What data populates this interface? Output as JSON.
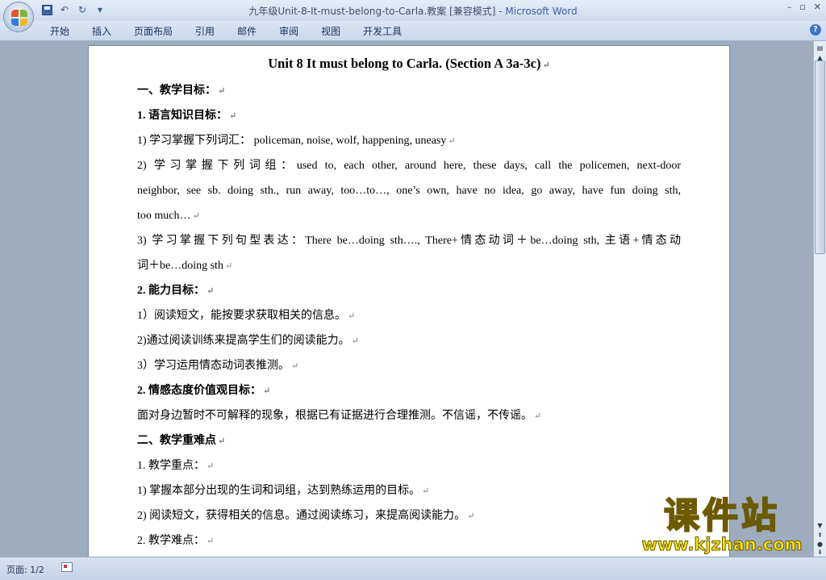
{
  "window": {
    "title": "九年级Unit-8-It-must-belong-to-Carla.教案 [兼容模式] -",
    "app_name": "Microsoft Word",
    "min": "–",
    "max": "▫",
    "close": "✕"
  },
  "ribbon": {
    "tabs": [
      "开始",
      "插入",
      "页面布局",
      "引用",
      "邮件",
      "审阅",
      "视图",
      "开发工具"
    ],
    "help": "?"
  },
  "document": {
    "title": "Unit 8 It must  belong to Carla. (Section A 3a-3c)",
    "paragraphs": [
      "一、教学目标：",
      "1. 语言知识目标：",
      "1) 学习掌握下列词汇：   policeman, noise, wolf, happening, uneasy",
      "2) 学习掌握下列词组：used to, each other, around here, these days, call the policemen, next-door",
      "neighbor, see sb. doing sth., run away, too…to…, one’s own, have no idea, go away, have fun doing sth,",
      "too much…",
      "3) 学习掌握下列句型表达：There be…doing sth…., There+情态动词＋be…doing sth, 主语+情态动",
      "词＋be…doing sth",
      "2. 能力目标：",
      "1）阅读短文，能按要求获取相关的信息。",
      "2)通过阅读训练来提高学生们的阅读能力。",
      "3）学习运用情态动词表推测。",
      "2. 情感态度价值观目标：",
      "面对身边暂时不可解释的现象，根据已有证据进行合理推测。不信谣，不传谣。",
      "二、教学重难点",
      "1. 教学重点：",
      "1) 掌握本部分出现的生词和词组，达到熟练运用的目标。",
      "2) 阅读短文，获得相关的信息。通过阅读练习，来提高阅读能力。",
      "2. 教学难点："
    ],
    "para_mark": "↵"
  },
  "status": {
    "page": "页面: 1/2"
  },
  "watermark": {
    "text": "课件站",
    "url": "www.kjzhan.com"
  },
  "colors": {
    "title_bar": "#dbe6f4",
    "workspace": "#9eacbf",
    "watermark_yellow": "#f5e600"
  }
}
